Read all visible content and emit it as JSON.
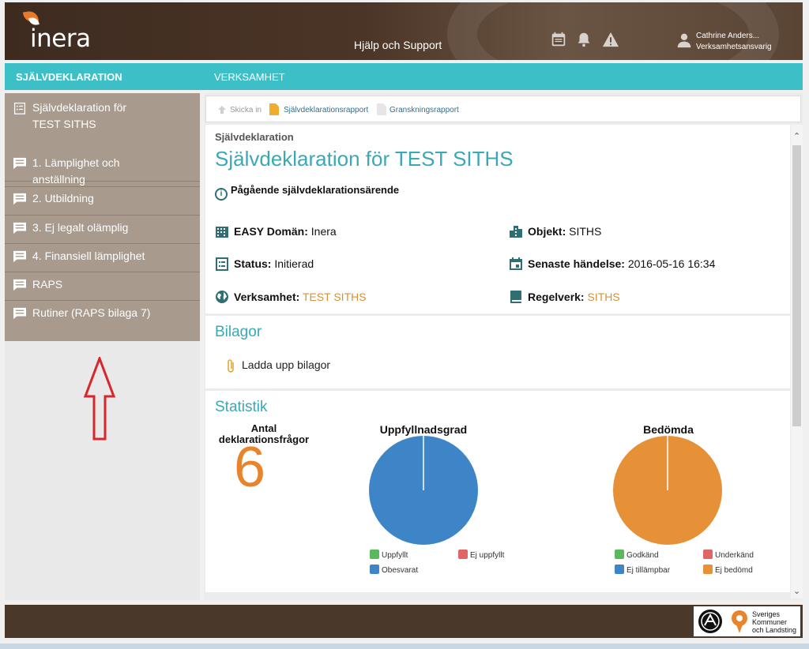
{
  "header": {
    "brand": "inera",
    "help_label": "Hjälp och Support",
    "icons": [
      "calendar-icon",
      "bell-icon",
      "warning-icon"
    ],
    "user_name": "Cathrine Anders...",
    "user_role": "Verksamhetsansvarig"
  },
  "nav": {
    "left": "SJÄLVDEKLARATION",
    "right": "VERKSAMHET"
  },
  "sidebar": {
    "items": [
      {
        "label": "Självdeklaration för TEST SITHS"
      },
      {
        "label": "1. Lämplighet och anställning"
      },
      {
        "label": "2. Utbildning"
      },
      {
        "label": "3. Ej legalt olämplig"
      },
      {
        "label": "4. Finansiell lämplighet"
      },
      {
        "label": "RAPS"
      },
      {
        "label": "Rutiner (RAPS bilaga 7)"
      }
    ]
  },
  "breadcrumb": {
    "send": "Skicka in",
    "report1": "Självdeklarationsrapport",
    "report2": "Granskningsrapport"
  },
  "declaration": {
    "subtitle": "Självdeklaration",
    "title": "Självdeklaration för TEST SITHS",
    "status_line": "Pågående självdeklarationsärende",
    "easy_domain_label": "EASY Domän:",
    "easy_domain_value": "Inera",
    "object_label": "Objekt:",
    "object_value": "SITHS",
    "status_label": "Status:",
    "status_value": "Initierad",
    "latest_label": "Senaste händelse:",
    "latest_value": "2016-05-16 16:34",
    "org_label": "Verksamhet:",
    "org_value": "TEST SITHS",
    "rules_label": "Regelverk:",
    "rules_value": "SITHS"
  },
  "attachments": {
    "title": "Bilagor",
    "upload_label": "Ladda upp bilagor"
  },
  "statistics": {
    "title": "Statistik",
    "count_label": "Antal deklarationsfrågor",
    "count_value": "6"
  },
  "chart_data": [
    {
      "type": "pie",
      "title": "Uppfyllnadsgrad",
      "categories": [
        "Uppfyllt",
        "Ej uppfyllt",
        "Obesvarat"
      ],
      "values": [
        0,
        0,
        6
      ],
      "colors": [
        "#5cb85c",
        "#e06666",
        "#3d85c6"
      ]
    },
    {
      "type": "pie",
      "title": "Bedömda",
      "categories": [
        "Godkänd",
        "Underkänd",
        "Ej tillämpbar",
        "Ej bedömd"
      ],
      "values": [
        0,
        0,
        0,
        6
      ],
      "colors": [
        "#5cb85c",
        "#e06666",
        "#3d85c6",
        "#e69138"
      ]
    }
  ],
  "footer": {
    "org_line1": "Sveriges",
    "org_line2": "Kommuner",
    "org_line3": "och Landsting"
  }
}
